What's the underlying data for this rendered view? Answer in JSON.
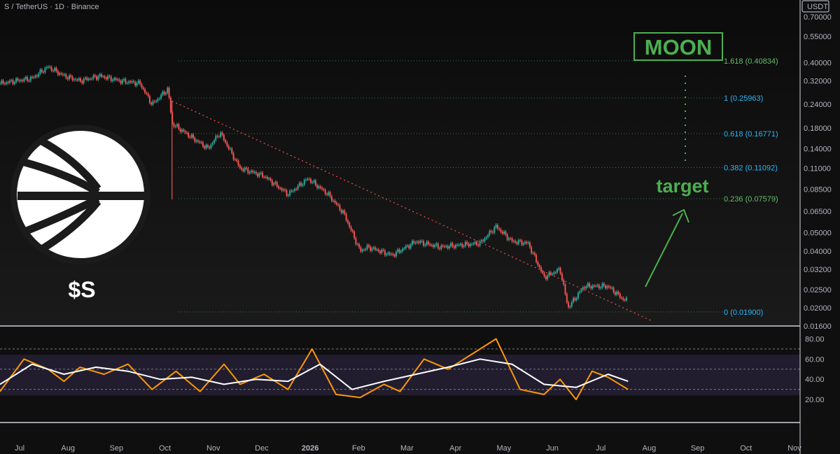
{
  "header": {
    "symbol_title": "S / TetherUS · 1D · Binance",
    "currency_badge": "USDT"
  },
  "colors": {
    "bull": "#26a69a",
    "bear": "#ef5350",
    "fib": "#2e7d5b",
    "fib_label_blue": "#29b6f6",
    "fib_label_green": "#66bb6a",
    "annotation_green": "#4caf50",
    "trendline": "#ef5350",
    "rsi": "#ff9800",
    "rsi_ma": "#ffffff"
  },
  "logo": {
    "caption": "$S"
  },
  "annotations": {
    "moon": "MOON",
    "target": "target"
  },
  "chart_data": [
    {
      "type": "candlestick",
      "scale": "log",
      "ylim": [
        0.016,
        0.7
      ],
      "y_ticks": [
        "0.70000",
        "0.55000",
        "0.40000",
        "0.32000",
        "0.24000",
        "0.18000",
        "0.14000",
        "0.11000",
        "0.08500",
        "0.06500",
        "0.05000",
        "0.04000",
        "0.03200",
        "0.02500",
        "0.02000",
        "0.01600"
      ],
      "x_ticks": [
        "Jul",
        "Aug",
        "Sep",
        "Oct",
        "Nov",
        "Dec",
        "2026",
        "Feb",
        "Mar",
        "Apr",
        "May",
        "Jun",
        "Jul",
        "Aug",
        "Sep",
        "Oct",
        "Nov"
      ],
      "path_points": [
        [
          0,
          0.31
        ],
        [
          0.04,
          0.33
        ],
        [
          0.06,
          0.38
        ],
        [
          0.08,
          0.34
        ],
        [
          0.1,
          0.32
        ],
        [
          0.125,
          0.34
        ],
        [
          0.15,
          0.32
        ],
        [
          0.175,
          0.31
        ],
        [
          0.19,
          0.24
        ],
        [
          0.21,
          0.29
        ],
        [
          0.215,
          0.19
        ],
        [
          0.24,
          0.16
        ],
        [
          0.26,
          0.14
        ],
        [
          0.275,
          0.17
        ],
        [
          0.3,
          0.11
        ],
        [
          0.33,
          0.1
        ],
        [
          0.36,
          0.08
        ],
        [
          0.385,
          0.097
        ],
        [
          0.41,
          0.08
        ],
        [
          0.43,
          0.063
        ],
        [
          0.45,
          0.04
        ],
        [
          0.46,
          0.042
        ],
        [
          0.49,
          0.038
        ],
        [
          0.52,
          0.045
        ],
        [
          0.55,
          0.042
        ],
        [
          0.6,
          0.044
        ],
        [
          0.62,
          0.054
        ],
        [
          0.64,
          0.045
        ],
        [
          0.66,
          0.044
        ],
        [
          0.68,
          0.029
        ],
        [
          0.7,
          0.032
        ],
        [
          0.71,
          0.02
        ],
        [
          0.73,
          0.026
        ],
        [
          0.76,
          0.026
        ],
        [
          0.78,
          0.022
        ],
        [
          0.785,
          0.022
        ]
      ],
      "fib_levels": [
        {
          "label": "1.618 (0.40834)",
          "value": 0.40834
        },
        {
          "label": "1 (0.25963)",
          "value": 0.25963
        },
        {
          "label": "0.618 (0.16771)",
          "value": 0.16771
        },
        {
          "label": "0.382 (0.11092)",
          "value": 0.11092
        },
        {
          "label": "0.236 (0.07579)",
          "value": 0.07579
        },
        {
          "label": "0 (0.01900)",
          "value": 0.019
        }
      ]
    },
    {
      "type": "line",
      "name": "",
      "ylim": [
        0,
        90
      ],
      "y_ticks": [
        "80.00",
        "60.00",
        "40.00",
        "20.00"
      ],
      "bands": [
        70,
        50,
        30
      ],
      "rsi_points": [
        [
          0,
          28
        ],
        [
          0.03,
          60
        ],
        [
          0.06,
          50
        ],
        [
          0.08,
          38
        ],
        [
          0.1,
          52
        ],
        [
          0.13,
          45
        ],
        [
          0.16,
          55
        ],
        [
          0.19,
          30
        ],
        [
          0.22,
          48
        ],
        [
          0.25,
          28
        ],
        [
          0.28,
          55
        ],
        [
          0.3,
          35
        ],
        [
          0.33,
          45
        ],
        [
          0.36,
          30
        ],
        [
          0.39,
          70
        ],
        [
          0.42,
          25
        ],
        [
          0.45,
          22
        ],
        [
          0.48,
          35
        ],
        [
          0.5,
          28
        ],
        [
          0.53,
          60
        ],
        [
          0.56,
          50
        ],
        [
          0.59,
          65
        ],
        [
          0.62,
          80
        ],
        [
          0.65,
          30
        ],
        [
          0.68,
          25
        ],
        [
          0.7,
          40
        ],
        [
          0.72,
          20
        ],
        [
          0.74,
          48
        ],
        [
          0.76,
          42
        ],
        [
          0.785,
          30
        ]
      ],
      "ma_points": [
        [
          0,
          35
        ],
        [
          0.04,
          55
        ],
        [
          0.08,
          45
        ],
        [
          0.12,
          52
        ],
        [
          0.16,
          48
        ],
        [
          0.2,
          40
        ],
        [
          0.24,
          42
        ],
        [
          0.28,
          35
        ],
        [
          0.32,
          40
        ],
        [
          0.36,
          38
        ],
        [
          0.4,
          55
        ],
        [
          0.44,
          30
        ],
        [
          0.48,
          38
        ],
        [
          0.52,
          45
        ],
        [
          0.56,
          52
        ],
        [
          0.6,
          60
        ],
        [
          0.64,
          55
        ],
        [
          0.68,
          35
        ],
        [
          0.72,
          32
        ],
        [
          0.76,
          45
        ],
        [
          0.785,
          38
        ]
      ]
    }
  ]
}
